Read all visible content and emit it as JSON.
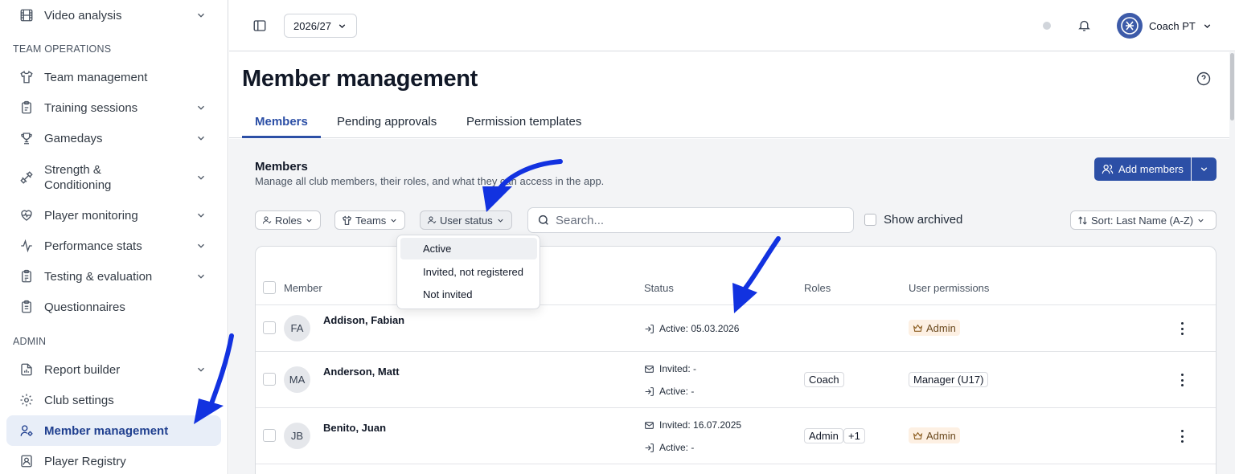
{
  "sidebar": {
    "sections": {
      "team_operations": "TEAM OPERATIONS",
      "admin": "ADMIN"
    },
    "items": [
      {
        "label": "Video analysis",
        "icon": "film-icon",
        "chevron": true
      },
      {
        "label": "Team management",
        "icon": "shirt-icon",
        "chevron": false
      },
      {
        "label": "Training sessions",
        "icon": "clipboard-icon",
        "chevron": true
      },
      {
        "label": "Gamedays",
        "icon": "trophy-icon",
        "chevron": true
      },
      {
        "label": "Strength &\nConditioning",
        "icon": "dumbbell-icon",
        "chevron": true
      },
      {
        "label": "Player monitoring",
        "icon": "heart-pulse-icon",
        "chevron": true
      },
      {
        "label": "Performance stats",
        "icon": "activity-icon",
        "chevron": true
      },
      {
        "label": "Testing & evaluation",
        "icon": "clipboard-check-icon",
        "chevron": true
      },
      {
        "label": "Questionnaires",
        "icon": "clipboard-list-icon",
        "chevron": false
      },
      {
        "label": "Report builder",
        "icon": "file-chart-icon",
        "chevron": true
      },
      {
        "label": "Club settings",
        "icon": "gear-icon",
        "chevron": false
      },
      {
        "label": "Member management",
        "icon": "user-cog-icon",
        "chevron": false,
        "active": true
      },
      {
        "label": "Player Registry",
        "icon": "id-card-icon",
        "chevron": false
      }
    ]
  },
  "topbar": {
    "season": "2026/27",
    "user_name": "Coach PT"
  },
  "page": {
    "title": "Member management",
    "tabs": [
      "Members",
      "Pending approvals",
      "Permission templates"
    ],
    "active_tab": "Members"
  },
  "members_section": {
    "title": "Members",
    "description": "Manage all club members, their roles, and what they can access in the app.",
    "add_button": "Add members"
  },
  "filters": {
    "roles": "Roles",
    "teams": "Teams",
    "user_status": "User status",
    "search_placeholder": "Search...",
    "show_archived": "Show archived",
    "sort": "Sort: Last Name (A-Z)"
  },
  "status_dropdown": {
    "options": [
      "Active",
      "Invited, not registered",
      "Not invited"
    ],
    "highlighted": "Active"
  },
  "table": {
    "columns": [
      "Member",
      "Status",
      "Roles",
      "User permissions"
    ],
    "rows": [
      {
        "initials": "FA",
        "name": "Addison, Fabian",
        "status": [
          "Active: 05.03.2026"
        ],
        "roles": [],
        "permission": "Admin",
        "permission_is_admin": true
      },
      {
        "initials": "MA",
        "name": "Anderson, Matt",
        "status": [
          "Invited: -",
          "Active: -"
        ],
        "roles": [
          "Coach"
        ],
        "permission": "Manager (U17)",
        "permission_is_admin": false
      },
      {
        "initials": "JB",
        "name": "Benito, Juan",
        "status": [
          "Invited: 16.07.2025",
          "Active: -"
        ],
        "roles": [
          "Admin",
          "+1"
        ],
        "permission": "Admin",
        "permission_is_admin": true
      }
    ]
  },
  "colors": {
    "primary": "#2c4fa6",
    "annotation_arrow": "#1232e0",
    "admin_badge_bg": "#fdf0e3",
    "active_nav_bg": "#e8eef8"
  }
}
